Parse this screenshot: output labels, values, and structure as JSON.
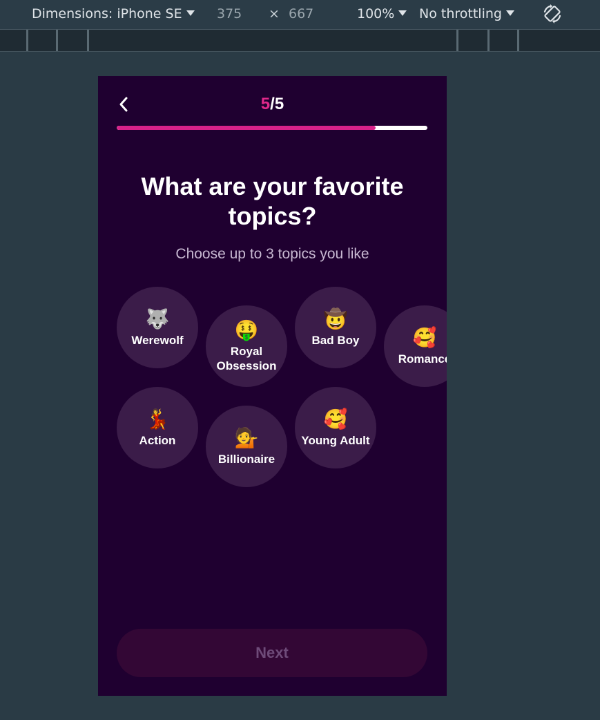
{
  "devtools": {
    "dimensions_label": "Dimensions: iPhone SE",
    "width": "375",
    "times": "×",
    "height": "667",
    "zoom": "100%",
    "throttling": "No throttling",
    "rotate_icon": "rotate-icon"
  },
  "header": {
    "back_icon": "chevron-left-icon",
    "step_current": "5",
    "step_separator": "/",
    "step_total": "5",
    "progress_fraction": 0.833
  },
  "title": "What are your favorite topics?",
  "subtitle": "Choose up to 3 topics you like",
  "topics": [
    {
      "emoji": "🐺",
      "label": "Werewolf"
    },
    {
      "emoji": "🤑",
      "label": "Royal Obsession"
    },
    {
      "emoji": "🤠",
      "label": "Bad Boy"
    },
    {
      "emoji": "🥰",
      "label": "Romance"
    },
    {
      "emoji": "💃",
      "label": "Action"
    },
    {
      "emoji": "💁",
      "label": "Billionaire"
    },
    {
      "emoji": "🥰",
      "label": "Young Adult"
    }
  ],
  "next_label": "Next",
  "colors": {
    "background": "#1f0030",
    "accent": "#e0288a",
    "chip": "#3b1c49",
    "next_disabled": "#330735"
  }
}
